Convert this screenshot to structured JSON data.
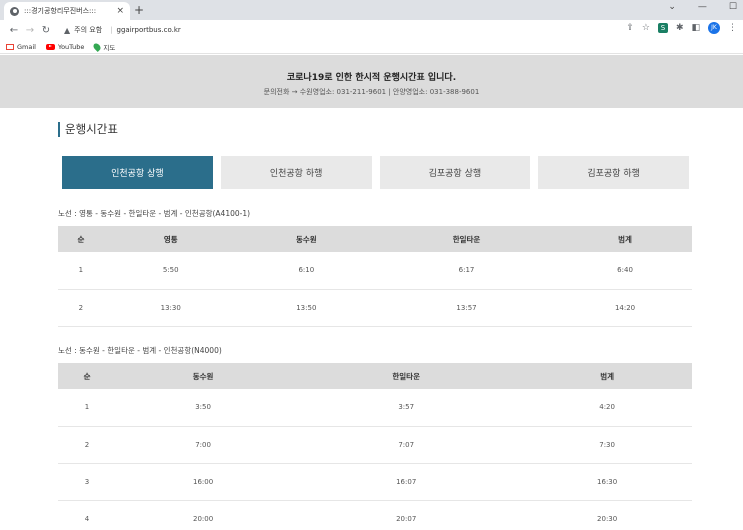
{
  "browser": {
    "tab_title": ":::경기공항리무진버스:::",
    "tab_close": "×",
    "new_tab": "+",
    "security_label": "주의 요함",
    "url": "ggairportbus.co.kr",
    "avatar": "JK",
    "ext_label": "S",
    "bookmarks": [
      "Gmail",
      "YouTube",
      "지도"
    ]
  },
  "notice": {
    "headline": "코로나19로 인한 한시적 운행시간표 입니다.",
    "contact": "문의전화 → 수원영업소: 031-211-9601 | 안양영업소: 031-388-9601"
  },
  "section_title": "운행시간표",
  "route_tabs": [
    {
      "label": "인천공항 상행",
      "active": true
    },
    {
      "label": "인천공항 하행",
      "active": false
    },
    {
      "label": "김포공항 상행",
      "active": false
    },
    {
      "label": "김포공항 하행",
      "active": false
    }
  ],
  "routes": [
    {
      "label": "노선 : 영통 - 동수원 - 한일타운 - 범계 - 인천공항(A4100-1)",
      "headers": [
        "순",
        "영통",
        "동수원",
        "한일타운",
        "범계"
      ],
      "rows": [
        [
          "1",
          "5:50",
          "6:10",
          "6:17",
          "6:40"
        ],
        [
          "2",
          "13:30",
          "13:50",
          "13:57",
          "14:20"
        ]
      ]
    },
    {
      "label": "노선 : 동수원 - 한일타운 - 범계 - 인천공항(N4000)",
      "headers": [
        "순",
        "동수원",
        "한일타운",
        "범계"
      ],
      "rows": [
        [
          "1",
          "3:50",
          "3:57",
          "4:20"
        ],
        [
          "2",
          "7:00",
          "7:07",
          "7:30"
        ],
        [
          "3",
          "16:00",
          "16:07",
          "16:30"
        ],
        [
          "4",
          "20:00",
          "20:07",
          "20:30"
        ]
      ]
    }
  ]
}
